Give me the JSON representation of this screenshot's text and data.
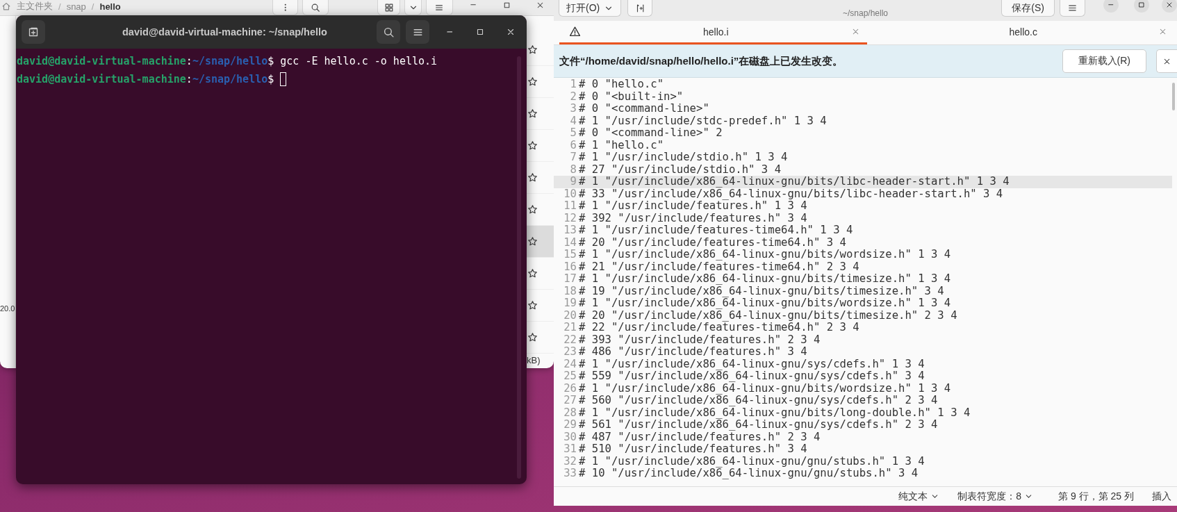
{
  "file_manager": {
    "breadcrumb": [
      {
        "kind": "crumb",
        "label": "主文件夹"
      },
      {
        "kind": "separator",
        "label": "/"
      },
      {
        "kind": "crumb",
        "label": "snap"
      },
      {
        "kind": "separator",
        "label": "/"
      },
      {
        "kind": "current",
        "label": "hello"
      }
    ],
    "left_fragment": "20.0",
    "size_fragment": "kB)",
    "rows": [
      {
        "starred": false,
        "selected": false
      },
      {
        "starred": false,
        "selected": false
      },
      {
        "starred": false,
        "selected": false
      },
      {
        "starred": false,
        "selected": false
      },
      {
        "starred": false,
        "selected": false
      },
      {
        "starred": false,
        "selected": false
      },
      {
        "starred": false,
        "selected": true
      },
      {
        "starred": false,
        "selected": false
      },
      {
        "starred": false,
        "selected": false
      },
      {
        "starred": false,
        "selected": false
      }
    ]
  },
  "terminal": {
    "title": "david@david-virtual-machine: ~/snap/hello",
    "lines": [
      {
        "user": "david@david-virtual-machine",
        "separator": ":",
        "path": "~/snap/hello",
        "prompt": "$",
        "command": "gcc -E hello.c -o hello.i",
        "cursor": false
      },
      {
        "user": "david@david-virtual-machine",
        "separator": ":",
        "path": "~/snap/hello",
        "prompt": "$",
        "cursor": true
      }
    ]
  },
  "editor": {
    "subtitle": "~/snap/hello",
    "open_button": "打开(O)",
    "save_button": "保存(S)",
    "tabs": [
      {
        "label": "hello.i",
        "selected": true,
        "warning": true
      },
      {
        "label": "hello.c",
        "selected": false,
        "warning": false
      }
    ],
    "infobar": {
      "message": "文件“/home/david/snap/hello/hello.i”在磁盘上已发生改变。",
      "button": "重新载入(R)"
    },
    "lines": [
      {
        "number": "1",
        "text": "# 0 \"hello.c\"",
        "current": false
      },
      {
        "number": "2",
        "text": "# 0 \"<built-in>\"",
        "current": false
      },
      {
        "number": "3",
        "text": "# 0 \"<command-line>\"",
        "current": false
      },
      {
        "number": "4",
        "text": "# 1 \"/usr/include/stdc-predef.h\" 1 3 4",
        "current": false
      },
      {
        "number": "5",
        "text": "# 0 \"<command-line>\" 2",
        "current": false
      },
      {
        "number": "6",
        "text": "# 1 \"hello.c\"",
        "current": false
      },
      {
        "number": "7",
        "text": "# 1 \"/usr/include/stdio.h\" 1 3 4",
        "current": false
      },
      {
        "number": "8",
        "text": "# 27 \"/usr/include/stdio.h\" 3 4",
        "current": false
      },
      {
        "number": "9",
        "text": "# 1 \"/usr/include/x86_64-linux-gnu/bits/libc-header-start.h\" 1 3 4",
        "current": true
      },
      {
        "number": "10",
        "text": "# 33 \"/usr/include/x86_64-linux-gnu/bits/libc-header-start.h\" 3 4",
        "current": false
      },
      {
        "number": "11",
        "text": "# 1 \"/usr/include/features.h\" 1 3 4",
        "current": false
      },
      {
        "number": "12",
        "text": "# 392 \"/usr/include/features.h\" 3 4",
        "current": false
      },
      {
        "number": "13",
        "text": "# 1 \"/usr/include/features-time64.h\" 1 3 4",
        "current": false
      },
      {
        "number": "14",
        "text": "# 20 \"/usr/include/features-time64.h\" 3 4",
        "current": false
      },
      {
        "number": "15",
        "text": "# 1 \"/usr/include/x86_64-linux-gnu/bits/wordsize.h\" 1 3 4",
        "current": false
      },
      {
        "number": "16",
        "text": "# 21 \"/usr/include/features-time64.h\" 2 3 4",
        "current": false
      },
      {
        "number": "17",
        "text": "# 1 \"/usr/include/x86_64-linux-gnu/bits/timesize.h\" 1 3 4",
        "current": false
      },
      {
        "number": "18",
        "text": "# 19 \"/usr/include/x86_64-linux-gnu/bits/timesize.h\" 3 4",
        "current": false
      },
      {
        "number": "19",
        "text": "# 1 \"/usr/include/x86_64-linux-gnu/bits/wordsize.h\" 1 3 4",
        "current": false
      },
      {
        "number": "20",
        "text": "# 20 \"/usr/include/x86_64-linux-gnu/bits/timesize.h\" 2 3 4",
        "current": false
      },
      {
        "number": "21",
        "text": "# 22 \"/usr/include/features-time64.h\" 2 3 4",
        "current": false
      },
      {
        "number": "22",
        "text": "# 393 \"/usr/include/features.h\" 2 3 4",
        "current": false
      },
      {
        "number": "23",
        "text": "# 486 \"/usr/include/features.h\" 3 4",
        "current": false
      },
      {
        "number": "24",
        "text": "# 1 \"/usr/include/x86_64-linux-gnu/sys/cdefs.h\" 1 3 4",
        "current": false
      },
      {
        "number": "25",
        "text": "# 559 \"/usr/include/x86_64-linux-gnu/sys/cdefs.h\" 3 4",
        "current": false
      },
      {
        "number": "26",
        "text": "# 1 \"/usr/include/x86_64-linux-gnu/bits/wordsize.h\" 1 3 4",
        "current": false
      },
      {
        "number": "27",
        "text": "# 560 \"/usr/include/x86_64-linux-gnu/sys/cdefs.h\" 2 3 4",
        "current": false
      },
      {
        "number": "28",
        "text": "# 1 \"/usr/include/x86_64-linux-gnu/bits/long-double.h\" 1 3 4",
        "current": false
      },
      {
        "number": "29",
        "text": "# 561 \"/usr/include/x86_64-linux-gnu/sys/cdefs.h\" 2 3 4",
        "current": false
      },
      {
        "number": "30",
        "text": "# 487 \"/usr/include/features.h\" 2 3 4",
        "current": false
      },
      {
        "number": "31",
        "text": "# 510 \"/usr/include/features.h\" 3 4",
        "current": false
      },
      {
        "number": "32",
        "text": "# 1 \"/usr/include/x86_64-linux-gnu/gnu/stubs.h\" 1 3 4",
        "current": false
      },
      {
        "number": "33",
        "text": "# 10 \"/usr/include/x86_64-linux-gnu/gnu/stubs.h\" 3 4",
        "current": false
      }
    ]
  },
  "status_bar": {
    "language": "纯文本",
    "tab_width": "制表符宽度：8",
    "position": "第 9 行，第 25 列",
    "mode": "插入"
  }
}
